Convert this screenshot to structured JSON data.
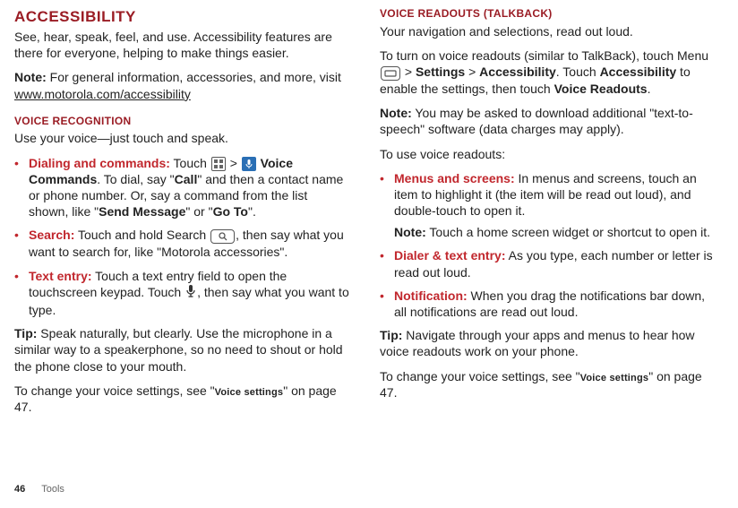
{
  "left": {
    "heading": "ACCESSIBILITY",
    "intro": "See, hear, speak, feel, and use. Accessibility features are there for everyone, helping to make things easier.",
    "note_label": "Note:",
    "note_text": " For general information, accessories, and more, visit ",
    "note_link": "www.motorola.com/accessibility",
    "sub1_heading": "VOICE RECOGNITION",
    "sub1_intro": "Use your voice—just touch and speak.",
    "b1_title": "Dialing and commands:",
    "b1_pre": " Touch ",
    "b1_gt": " > ",
    "b1_vc": " Voice Commands",
    "b1_body1": ". To dial, say \"",
    "b1_call": "Call",
    "b1_body2": "\" and then a contact name or phone number. Or, say a command from the list shown, like \"",
    "b1_sm": "Send Message",
    "b1_body3": "\" or \"",
    "b1_goto": "Go To",
    "b1_body4": "\".",
    "b2_title": "Search:",
    "b2_pre": " Touch and hold Search ",
    "b2_body": ", then say what you want to search for, like \"Motorola accessories\".",
    "b3_title": "Text entry:",
    "b3_pre": " Touch a text entry field to open the touchscreen keypad. Touch ",
    "b3_body": ", then say what you want to type.",
    "tip_label": "Tip:",
    "tip_text": " Speak naturally, but clearly. Use the microphone in a similar way to a speakerphone, so no need to shout or hold the phone close to your mouth.",
    "change_pre": "To change your voice settings, see \"",
    "change_ref": "Voice settings",
    "change_post": "\" on page 47."
  },
  "right": {
    "heading": "VOICE READOUTS (TALKBACK)",
    "intro": "Your navigation and selections, read out loud.",
    "p2_pre": "To turn on voice readouts (similar to TalkBack), touch Menu ",
    "p2_gt": " > ",
    "p2_settings": "Settings",
    "p2_gt2": " > ",
    "p2_access": "Accessibility",
    "p2_touch": ". Touch ",
    "p2_access2": "Accessibility",
    "p2_enable": " to enable the settings, then touch ",
    "p2_vr": "Voice Readouts",
    "p2_period": ".",
    "note_label": "Note:",
    "note_text": " You may be asked to download additional \"text-to-speech\" software (data charges may apply).",
    "use_intro": "To use voice readouts:",
    "b1_title": "Menus and screens:",
    "b1_body": " In menus and screens, touch an item to highlight it (the item will be read out loud), and double-touch to open it.",
    "b1_note_label": "Note:",
    "b1_note": " Touch a home screen widget or shortcut to open it.",
    "b2_title": "Dialer & text entry:",
    "b2_body": " As you type, each number or letter is read out loud.",
    "b3_title": "Notification:",
    "b3_body": " When you drag the notifications bar down, all notifications are read out loud.",
    "tip_label": "Tip:",
    "tip_text": " Navigate through your apps and menus to hear how voice readouts work on your phone.",
    "change_pre": "To change your voice settings, see \"",
    "change_ref": "Voice settings",
    "change_post": "\" on page 47."
  },
  "footer": {
    "page": "46",
    "section": "Tools"
  }
}
